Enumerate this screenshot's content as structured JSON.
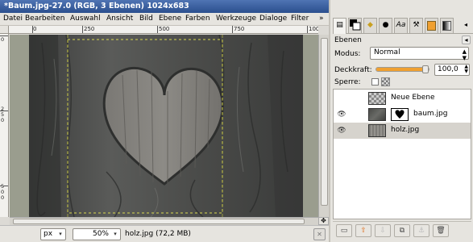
{
  "window": {
    "title": "*Baum.jpg-27.0 (RGB, 3 Ebenen) 1024x683"
  },
  "menu": [
    "Datei",
    "Bearbeiten",
    "Auswahl",
    "Ansicht",
    "Bild",
    "Ebene",
    "Farben",
    "Werkzeuge",
    "Dialoge",
    "Filter"
  ],
  "menu_more": "»",
  "ruler": {
    "h_labels": [
      "0",
      "250",
      "500",
      "750",
      "1000"
    ],
    "v_labels": [
      "0",
      "2",
      "5",
      "0",
      "5",
      "0",
      "0"
    ]
  },
  "status": {
    "unit": "px",
    "zoom": "50%",
    "info": "holz.jpg (72,2 MB)"
  },
  "dock": {
    "tabs": [
      "layers-tab",
      "color-tab",
      "brush-tab",
      "font-tab",
      "patterns-tab",
      "gradient-tab"
    ],
    "panel_title": "Ebenen",
    "mode_label": "Modus:",
    "mode_value": "Normal",
    "opacity_label": "Deckkraft:",
    "opacity_value": "100,0",
    "opacity_fraction": 1.0,
    "lock_label": "Sperre:",
    "layers": [
      {
        "name": "Neue Ebene",
        "visible": false,
        "mask": false,
        "selected": false
      },
      {
        "name": "baum.jpg",
        "visible": true,
        "mask": true,
        "selected": false
      },
      {
        "name": "holz.jpg",
        "visible": true,
        "mask": false,
        "selected": true
      }
    ]
  },
  "colors": {
    "title_bg": "#3a5f9f",
    "selection": "#d6d3cd",
    "accent": "#f0a030"
  }
}
